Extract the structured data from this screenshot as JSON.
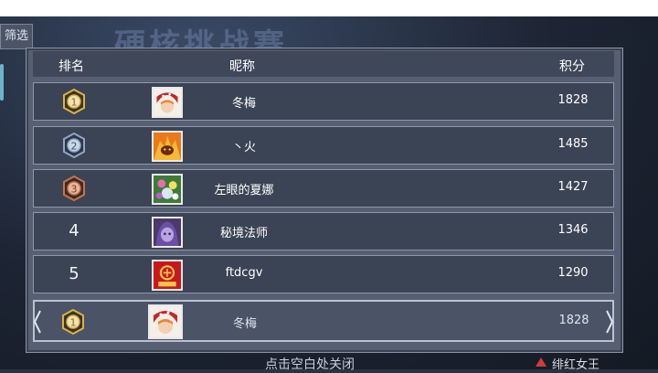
{
  "background": {
    "title": "硬核挑战赛"
  },
  "filter_button": "筛选",
  "header": {
    "rank": "排名",
    "nickname": "昵称",
    "score": "积分"
  },
  "rows": [
    {
      "rank": "1",
      "name": "冬梅",
      "score": "1828",
      "avatar": "red-hood-avatar"
    },
    {
      "rank": "2",
      "name": "丶火",
      "score": "1485",
      "avatar": "fire-demon-avatar"
    },
    {
      "rank": "3",
      "name": "左眼的夏娜",
      "score": "1427",
      "avatar": "green-flower-avatar"
    },
    {
      "rank": "4",
      "name": "秘境法师",
      "score": "1346",
      "avatar": "purple-mage-avatar"
    },
    {
      "rank": "5",
      "name": "ftdcgv",
      "score": "1290",
      "avatar": "red-2020-avatar"
    }
  ],
  "self_row": {
    "rank": "1",
    "name": "冬梅",
    "score": "1828",
    "avatar": "red-hood-avatar"
  },
  "bottom_hint": "点击空白处关闭",
  "corner_label": "绯红女王",
  "colors": {
    "gold": "#d9b24a",
    "silver": "#8fa6c6",
    "bronze": "#c7734c"
  }
}
